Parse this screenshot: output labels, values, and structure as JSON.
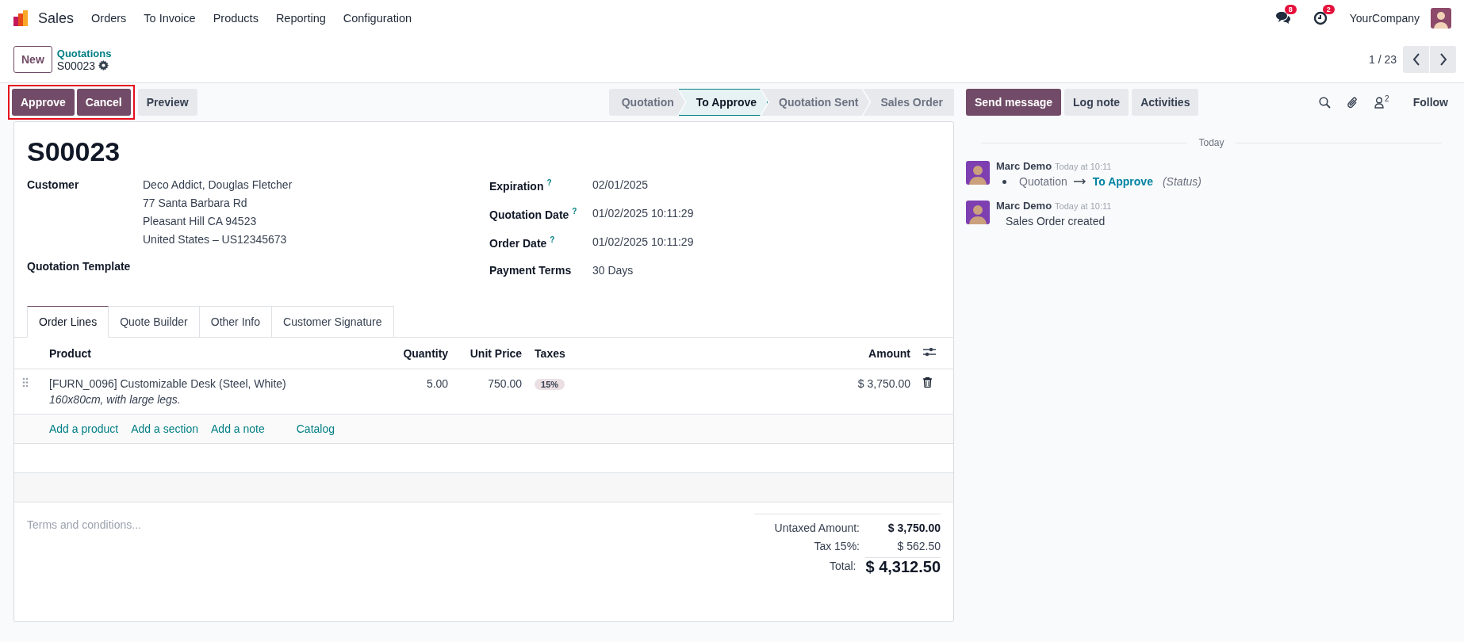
{
  "navbar": {
    "app": "Sales",
    "menu": [
      "Orders",
      "To Invoice",
      "Products",
      "Reporting",
      "Configuration"
    ],
    "messages_badge": "8",
    "activities_badge": "2",
    "company": "YourCompany"
  },
  "control_panel": {
    "new_button": "New",
    "breadcrumb": "Quotations",
    "record": "S00023",
    "pager": "1 / 23"
  },
  "actions": [
    {
      "label": "Approve",
      "kind": "primary"
    },
    {
      "label": "Cancel",
      "kind": "primary"
    },
    {
      "label": "Preview",
      "kind": "secondary"
    }
  ],
  "statusbar": [
    {
      "label": "Quotation",
      "selected": false
    },
    {
      "label": "To Approve",
      "selected": true
    },
    {
      "label": "Quotation Sent",
      "selected": false
    },
    {
      "label": "Sales Order",
      "selected": false
    }
  ],
  "form": {
    "title": "S00023",
    "left_fields": [
      {
        "label": "Customer",
        "lines": [
          "Deco Addict, Douglas Fletcher",
          "77 Santa Barbara Rd",
          "Pleasant Hill CA 94523",
          "United States – US12345673"
        ]
      },
      {
        "label": "Quotation Template"
      }
    ],
    "right_fields": [
      {
        "label": "Expiration",
        "help": "?",
        "value": "02/01/2025"
      },
      {
        "label": "Quotation Date",
        "help": "?",
        "value": "01/02/2025 10:11:29"
      },
      {
        "label": "Order Date",
        "help": "?",
        "value": "01/02/2025 10:11:29"
      },
      {
        "label": "Payment Terms",
        "value": "30 Days"
      }
    ],
    "tabs": [
      {
        "label": "Order Lines",
        "selected": true
      },
      {
        "label": "Quote Builder",
        "selected": false
      },
      {
        "label": "Other Info",
        "selected": false
      },
      {
        "label": "Customer Signature",
        "selected": false
      }
    ],
    "table": {
      "columns": [
        "Product",
        "Quantity",
        "Unit Price",
        "Taxes",
        "Amount"
      ],
      "rows": [
        {
          "product": "[FURN_0096] Customizable Desk (Steel, White)",
          "description": "160x80cm, with large legs.",
          "quantity": "5.00",
          "unit_price": "750.00",
          "taxes": "15%",
          "amount": "$ 3,750.00"
        }
      ],
      "add_links": [
        "Add a product",
        "Add a section",
        "Add a note",
        "Catalog"
      ]
    },
    "terms_placeholder": "Terms and conditions...",
    "totals": [
      {
        "label": "Untaxed Amount:",
        "value": "$ 3,750.00",
        "kind": "bold"
      },
      {
        "label": "Tax 15%:",
        "value": "$ 562.50",
        "kind": "normal"
      },
      {
        "label": "Total:",
        "value": "$ 4,312.50",
        "kind": "total"
      }
    ]
  },
  "chatter": {
    "buttons": [
      {
        "label": "Send message",
        "kind": "primary"
      },
      {
        "label": "Log note",
        "kind": "secondary"
      },
      {
        "label": "Activities",
        "kind": "secondary"
      }
    ],
    "followers_count": "2",
    "follow": "Follow",
    "date_separator": "Today",
    "messages": [
      {
        "author": "Marc Demo",
        "time": "Today at 10:11",
        "kind": "tracking",
        "old": "Quotation",
        "new": "To Approve",
        "field": "(Status)"
      },
      {
        "author": "Marc Demo",
        "time": "Today at 10:11",
        "kind": "text",
        "body": "Sales Order created"
      }
    ]
  }
}
